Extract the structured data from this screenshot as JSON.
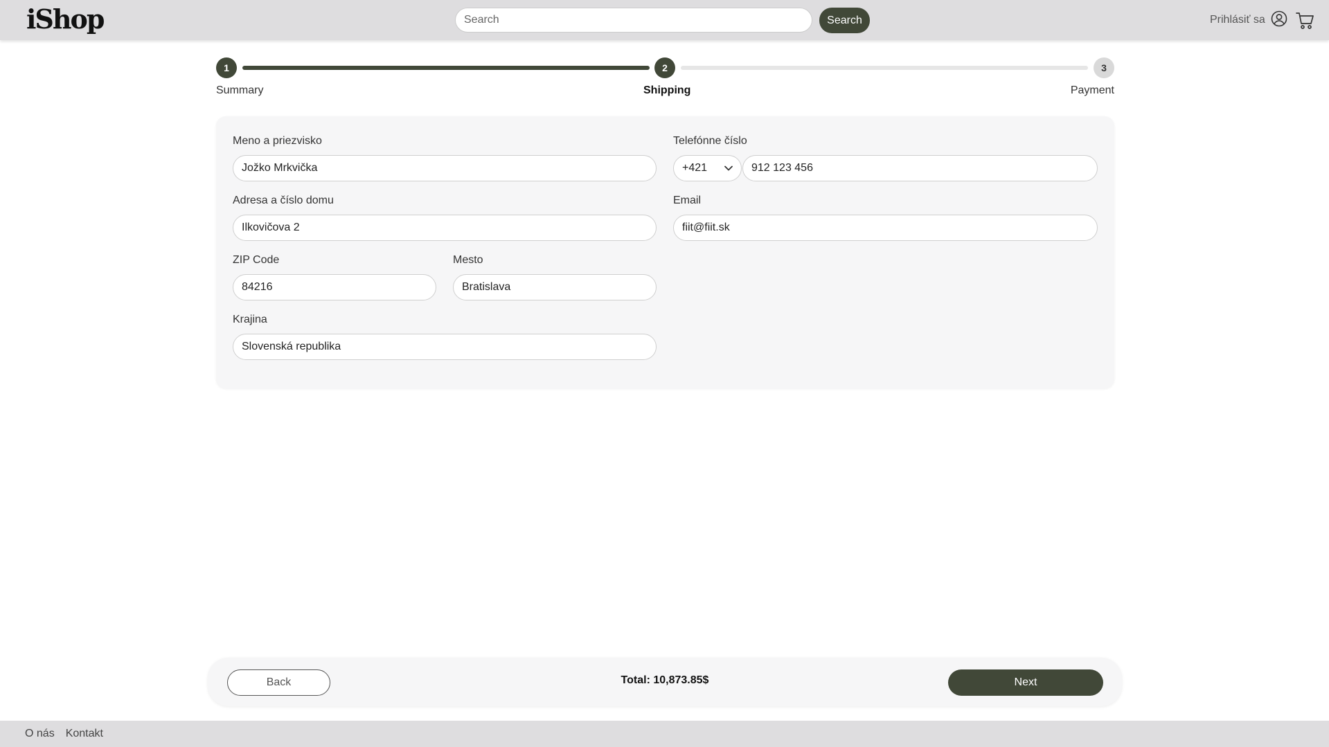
{
  "header": {
    "logo": "iShop",
    "search_placeholder": "Search",
    "search_button": "Search",
    "login_label": "Prihlásiť sa"
  },
  "stepper": {
    "steps": [
      {
        "number": "1",
        "label": "Summary",
        "state": "done"
      },
      {
        "number": "2",
        "label": "Shipping",
        "state": "current"
      },
      {
        "number": "3",
        "label": "Payment",
        "state": "todo"
      }
    ]
  },
  "form": {
    "name_label": "Meno a priezvisko",
    "name_value": "Jožko Mrkvička",
    "phone_label": "Telefónne číslo",
    "phone_country_code": "+421",
    "phone_value": "912 123 456",
    "address_label": "Adresa a číslo domu",
    "address_value": "Ilkovičova 2",
    "email_label": "Email",
    "email_value": "fiit@fiit.sk",
    "zip_label": "ZIP Code",
    "zip_value": "84216",
    "city_label": "Mesto",
    "city_value": "Bratislava",
    "country_label": "Krajina",
    "country_value": "Slovenská republika"
  },
  "bottom_bar": {
    "back_label": "Back",
    "total_label": "Total: 10,873.85$",
    "next_label": "Next"
  },
  "footer": {
    "links": [
      "O nás",
      "Kontakt"
    ]
  },
  "colors": {
    "accent": "#414838",
    "header_bg": "#dedddf",
    "card_bg": "#f6f6f7"
  }
}
